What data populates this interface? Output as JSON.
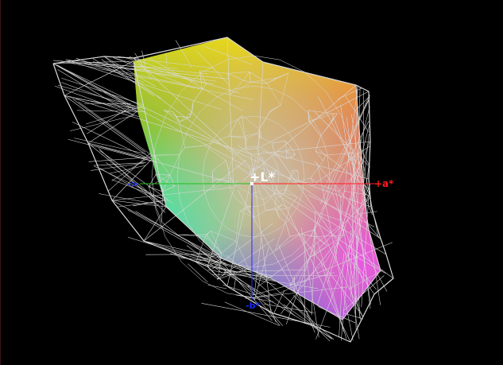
{
  "axes": {
    "lightness": {
      "label": "+L*",
      "color": "#ffffff"
    },
    "a": {
      "label": "+a*",
      "color": "#ff1a1a"
    },
    "b": {
      "label": "-b*",
      "color": "#1a2cff"
    },
    "neg_a_color": "#00cc00"
  },
  "colors": {
    "background": "#000000",
    "wireframe": "#d9d9d9",
    "gamut_green": "#57d62a",
    "gamut_yellow": "#e6dc10",
    "gamut_orange": "#ee9a2e",
    "gamut_red": "#f2504f",
    "gamut_magenta": "#e55ae5",
    "gamut_violet": "#8c5af2",
    "gamut_cyan": "#4ae0c0",
    "gamut_neutral": "#b8b8b0"
  }
}
